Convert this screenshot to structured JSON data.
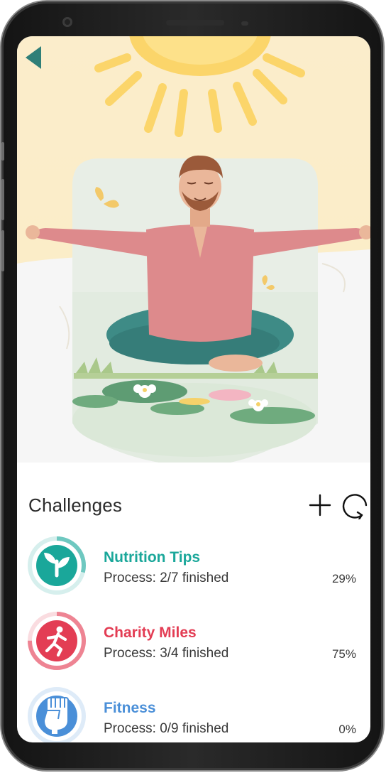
{
  "colors": {
    "accent_teal": "#1aa79a",
    "accent_red": "#e33d54",
    "accent_blue": "#4a8fd8",
    "sky": "#fbedcb"
  },
  "nav": {
    "back_icon": "back-arrow-icon"
  },
  "challenges": {
    "title": "Challenges",
    "add_icon": "plus-icon",
    "refresh_icon": "refresh-icon",
    "items": [
      {
        "name": "Nutrition Tips",
        "process": "Process: 2/7 finished",
        "percent_label": "29%",
        "progress": 0.29,
        "icon": "sprout-icon",
        "color": "#1aa79a"
      },
      {
        "name": "Charity Miles",
        "process": "Process: 3/4 finished",
        "percent_label": "75%",
        "progress": 0.75,
        "icon": "running-person-icon",
        "color": "#e33d54"
      },
      {
        "name": "Fitness",
        "process": "Process: 0/9 finished",
        "percent_label": "0%",
        "progress": 0.0,
        "icon": "raised-fist-icon",
        "color": "#4a8fd8"
      }
    ]
  }
}
